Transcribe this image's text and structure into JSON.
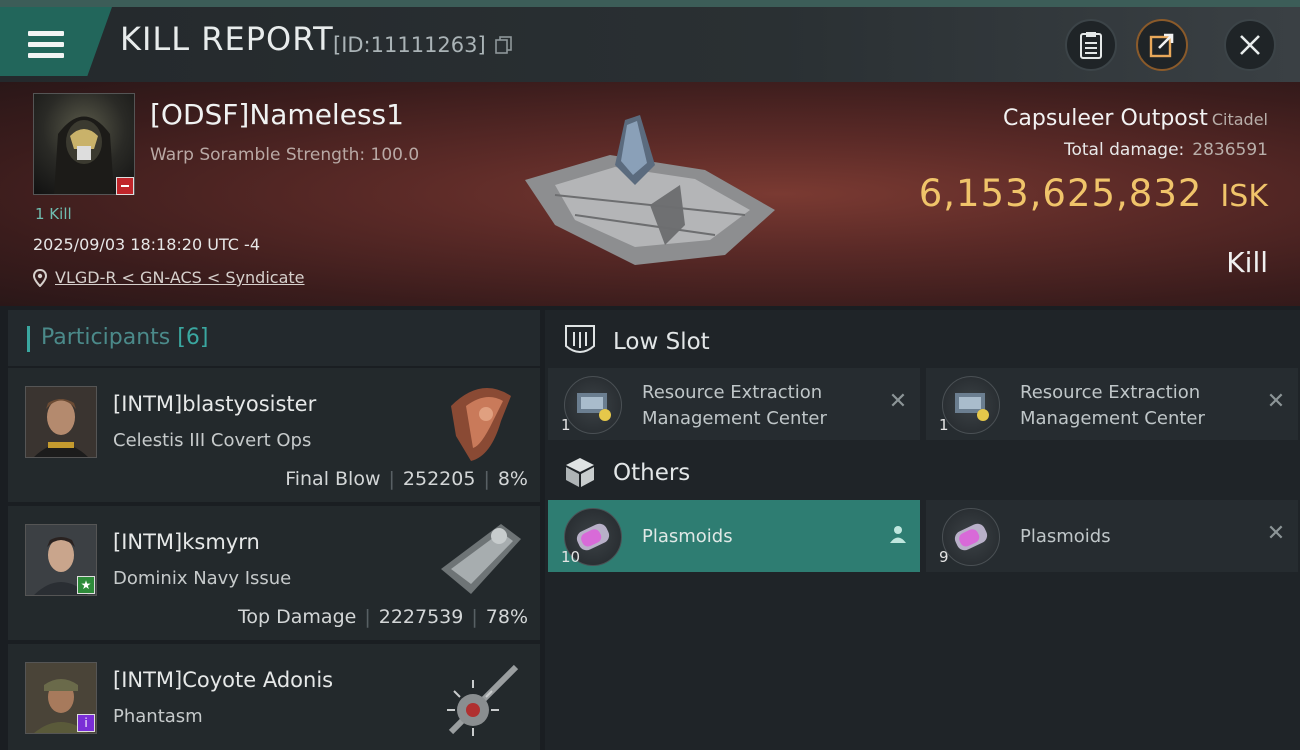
{
  "header": {
    "title": "KILL REPORT",
    "report_id": "[ID:11111263]",
    "icons": [
      "menu-icon",
      "copy-icon",
      "clipboard-icon",
      "share-icon",
      "close-icon"
    ]
  },
  "victim": {
    "name": "[ODSF]Nameless1",
    "warp_scramble": "Warp Soramble Strength: 100.0",
    "kills": "1 Kill",
    "timestamp": "2025/09/03 18:18:20 UTC -4",
    "location": "VLGD-R < GN-ACS < Syndicate"
  },
  "target": {
    "name": "Capsuleer Outpost",
    "type": "Citadel",
    "total_damage_label": "Total damage:",
    "total_damage": "2836591",
    "isk_value": "6,153,625,832",
    "isk_unit": "ISK",
    "result": "Kill"
  },
  "participants": {
    "title": "Participants",
    "count": "[6]",
    "list": [
      {
        "name": "[INTM]blastyosister",
        "ship": "Celestis III Covert Ops",
        "label": "Final Blow",
        "damage": "252205",
        "percent": "8%",
        "badge_color": ""
      },
      {
        "name": "[INTM]ksmyrn",
        "ship": "Dominix Navy Issue",
        "label": "Top Damage",
        "damage": "2227539",
        "percent": "78%",
        "badge_color": "#2e8b3a"
      },
      {
        "name": "[INTM]Coyote Adonis",
        "ship": "Phantasm",
        "label": "",
        "damage": "",
        "percent": "",
        "badge_color": "#7a2ed6"
      }
    ]
  },
  "low_slot": {
    "title": "Low Slot",
    "items": [
      {
        "name": "Resource Extraction Management Center",
        "qty": "1"
      },
      {
        "name": "Resource Extraction Management Center",
        "qty": "1"
      }
    ]
  },
  "others": {
    "title": "Others",
    "items": [
      {
        "name": "Plasmoids",
        "qty": "10",
        "selected": true
      },
      {
        "name": "Plasmoids",
        "qty": "9",
        "selected": false
      }
    ]
  },
  "colors": {
    "accent": "#2e7d72",
    "isk": "#f0c46a",
    "participant_accent": "#3aa7a0"
  }
}
